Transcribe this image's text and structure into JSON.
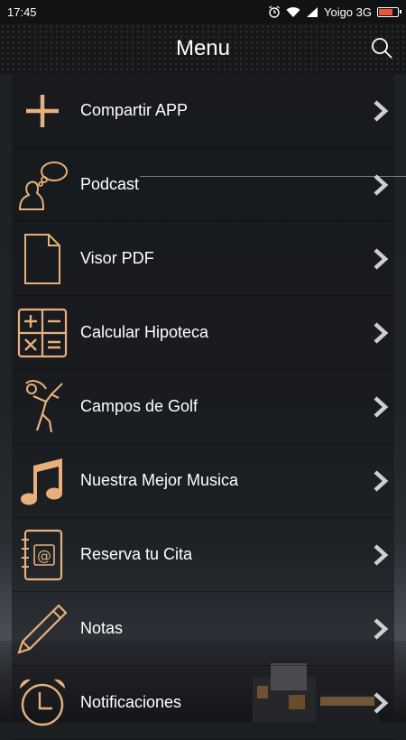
{
  "status_bar": {
    "time": "17:45",
    "carrier": "Yoigo 3G",
    "battery_level": 0.7,
    "icons": [
      "alarm-icon",
      "wifi-icon",
      "signal-icon",
      "battery-icon"
    ]
  },
  "header": {
    "title": "Menu",
    "search_icon": "search-icon"
  },
  "colors": {
    "accent": "#e7b07c",
    "text": "#ffffff",
    "chevron": "#cfcfcf"
  },
  "menu": {
    "items": [
      {
        "label": "Compartir APP",
        "icon": "plus-icon"
      },
      {
        "label": "Podcast",
        "icon": "speech-person-icon"
      },
      {
        "label": "Visor PDF",
        "icon": "document-icon"
      },
      {
        "label": "Calcular Hipoteca",
        "icon": "calculator-icon"
      },
      {
        "label": "Campos de Golf",
        "icon": "golfer-icon"
      },
      {
        "label": "Nuestra Mejor Musica",
        "icon": "music-note-icon"
      },
      {
        "label": "Reserva tu Cita",
        "icon": "address-book-icon"
      },
      {
        "label": "Notas",
        "icon": "pencil-icon"
      },
      {
        "label": "Notificaciones",
        "icon": "alarm-clock-icon"
      }
    ]
  }
}
